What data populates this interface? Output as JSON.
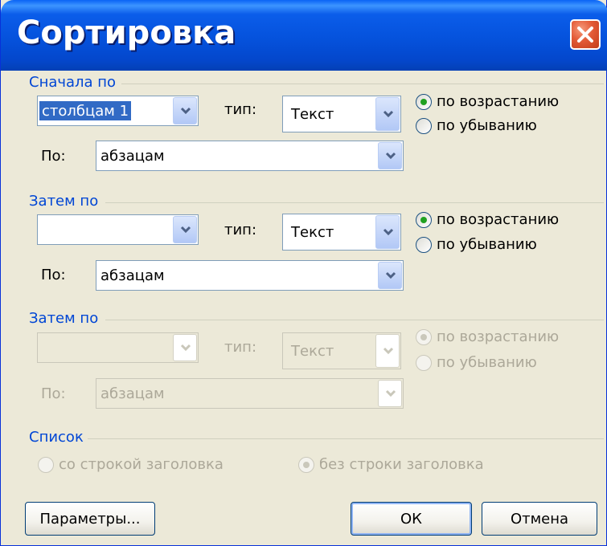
{
  "window": {
    "title": "Сортировка",
    "close_icon": "close-icon"
  },
  "section1": {
    "label": "Сначала по",
    "column_value": "столбцам 1",
    "type_label": "тип:",
    "type_value": "Текст",
    "by_label": "По:",
    "by_value": "абзацам",
    "asc_label": "по возрастанию",
    "desc_label": "по убыванию",
    "selected": "asc"
  },
  "section2": {
    "label": "Затем по",
    "column_value": "",
    "type_label": "тип:",
    "type_value": "Текст",
    "by_label": "По:",
    "by_value": "абзацам",
    "asc_label": "по возрастанию",
    "desc_label": "по убыванию",
    "selected": "asc"
  },
  "section3": {
    "label": "Затем по",
    "column_value": "",
    "type_label": "тип:",
    "type_value": "Текст",
    "by_label": "По:",
    "by_value": "абзацам",
    "asc_label": "по возрастанию",
    "desc_label": "по убыванию",
    "selected": "asc",
    "disabled": true
  },
  "list": {
    "label": "Список",
    "with_header_label": "со строкой заголовка",
    "no_header_label": "без строки заголовка",
    "selected": "no_header",
    "disabled": true
  },
  "buttons": {
    "options": "Параметры...",
    "ok": "ОК",
    "cancel": "Отмена"
  },
  "colors": {
    "title_bar": "#0552dc",
    "section_label": "#0046d5",
    "disabled_text": "#aca899",
    "dialog_bg": "#ece9d8"
  }
}
